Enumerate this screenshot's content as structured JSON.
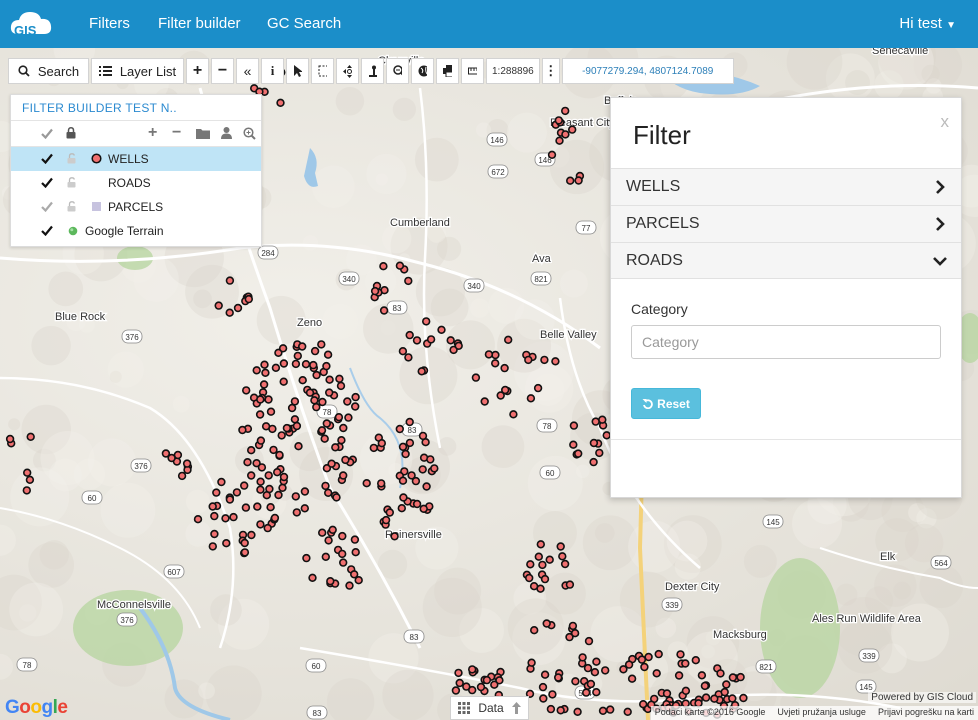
{
  "nav": {
    "logo": "GIS",
    "links": [
      "Filters",
      "Filter builder",
      "GC Search"
    ],
    "user": "Hi test"
  },
  "toolbar": {
    "search_label": "Search",
    "layerlist_label": "Layer List",
    "scale": "1:288896",
    "coords": "-9077279.294, 4807124.7089"
  },
  "layer_panel": {
    "title": "FILTER BUILDER TEST N..",
    "layers": [
      {
        "label": "WELLS",
        "symbol": "red-circle",
        "selected": true
      },
      {
        "label": "ROADS",
        "symbol": "none",
        "selected": false
      },
      {
        "label": "PARCELS",
        "symbol": "lavender-square",
        "selected": false
      },
      {
        "label": "Google Terrain",
        "symbol": "green-globe",
        "selected": false
      }
    ]
  },
  "filter_panel": {
    "title": "Filter",
    "close": "x",
    "sections": [
      {
        "label": "WELLS",
        "state": "collapsed"
      },
      {
        "label": "PARCELS",
        "state": "collapsed"
      },
      {
        "label": "ROADS",
        "state": "expanded"
      }
    ],
    "category_label": "Category",
    "category_placeholder": "Category",
    "reset_label": "Reset"
  },
  "map_labels": {
    "places": [
      "Claysville",
      "Senecaville",
      "Buffalo",
      "Pleasant City",
      "Cumberland",
      "Ava",
      "Blue Rock",
      "Zeno",
      "Belle Valley",
      "Reinersville",
      "Dexter City",
      "McConnelsville",
      "Macksburg",
      "Ales Run Wildlife Area",
      "Elk"
    ],
    "route_shields": [
      "146",
      "672",
      "146",
      "77",
      "284",
      "340",
      "821",
      "83",
      "340",
      "376",
      "83",
      "78",
      "78",
      "60",
      "376",
      "339",
      "145",
      "564",
      "607",
      "376",
      "60",
      "339",
      "83",
      "145",
      "564",
      "821",
      "78",
      "60",
      "83"
    ]
  },
  "bottom": {
    "data_label": "Data",
    "powered": "Powered by GIS Cloud",
    "google": "Google",
    "attribution": [
      "Podaci karte ©2016 Google",
      "Uvjeti pružanja usluge",
      "Prijavi pogrešku na karti"
    ]
  },
  "colors": {
    "nav_bg": "#1b8ec9",
    "well_fill": "#f07070",
    "selected_row": "#bfe4f6",
    "reset_btn": "#5bc0de"
  }
}
